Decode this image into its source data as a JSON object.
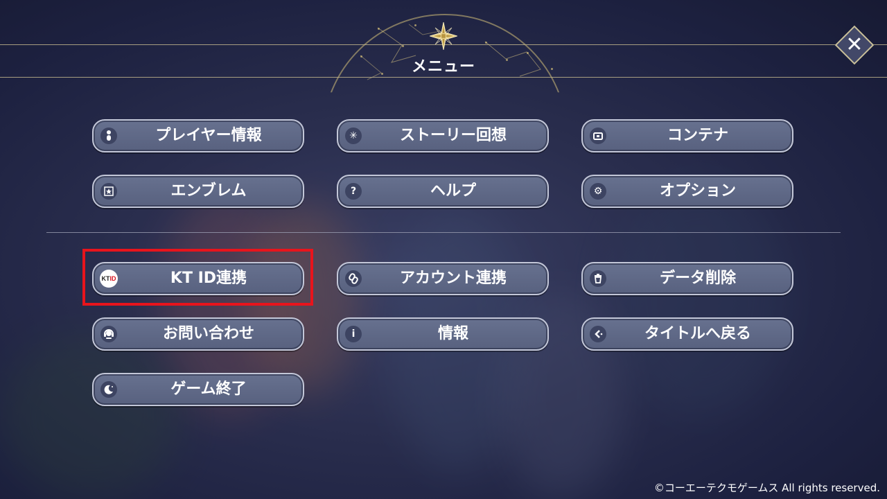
{
  "header": {
    "title": "メニュー",
    "close_icon": "close-x-icon"
  },
  "menu": {
    "top_items": [
      {
        "label": "プレイヤー情報",
        "icon": "person-icon"
      },
      {
        "label": "ストーリー回想",
        "icon": "sparkle-icon"
      },
      {
        "label": "コンテナ",
        "icon": "container-icon"
      },
      {
        "label": "エンブレム",
        "icon": "emblem-icon"
      },
      {
        "label": "ヘルプ",
        "icon": "question-icon"
      },
      {
        "label": "オプション",
        "icon": "gear-icon"
      }
    ],
    "bottom_items": [
      {
        "label": "KT ID連携",
        "icon": "kt-id-logo-icon",
        "icon_text_black": "KT",
        "icon_text_red": "ID"
      },
      {
        "label": "アカウント連携",
        "icon": "link-icon"
      },
      {
        "label": "データ削除",
        "icon": "trash-icon"
      },
      {
        "label": "お問い合わせ",
        "icon": "support-headset-icon"
      },
      {
        "label": "情報",
        "icon": "info-icon"
      },
      {
        "label": "タイトルへ戻る",
        "icon": "back-arrow-icon"
      },
      {
        "label": "ゲーム終了",
        "icon": "moon-icon"
      }
    ]
  },
  "highlight": {
    "target": "KT ID連携",
    "color": "#e8141c"
  },
  "footer": {
    "copyright": "©コーエーテクモゲームス All rights reserved."
  },
  "colors": {
    "background": "#2a2e4e",
    "button_fill": "#5f6886",
    "button_border": "#c3c7d8",
    "gold_accent": "#d9c27a"
  }
}
